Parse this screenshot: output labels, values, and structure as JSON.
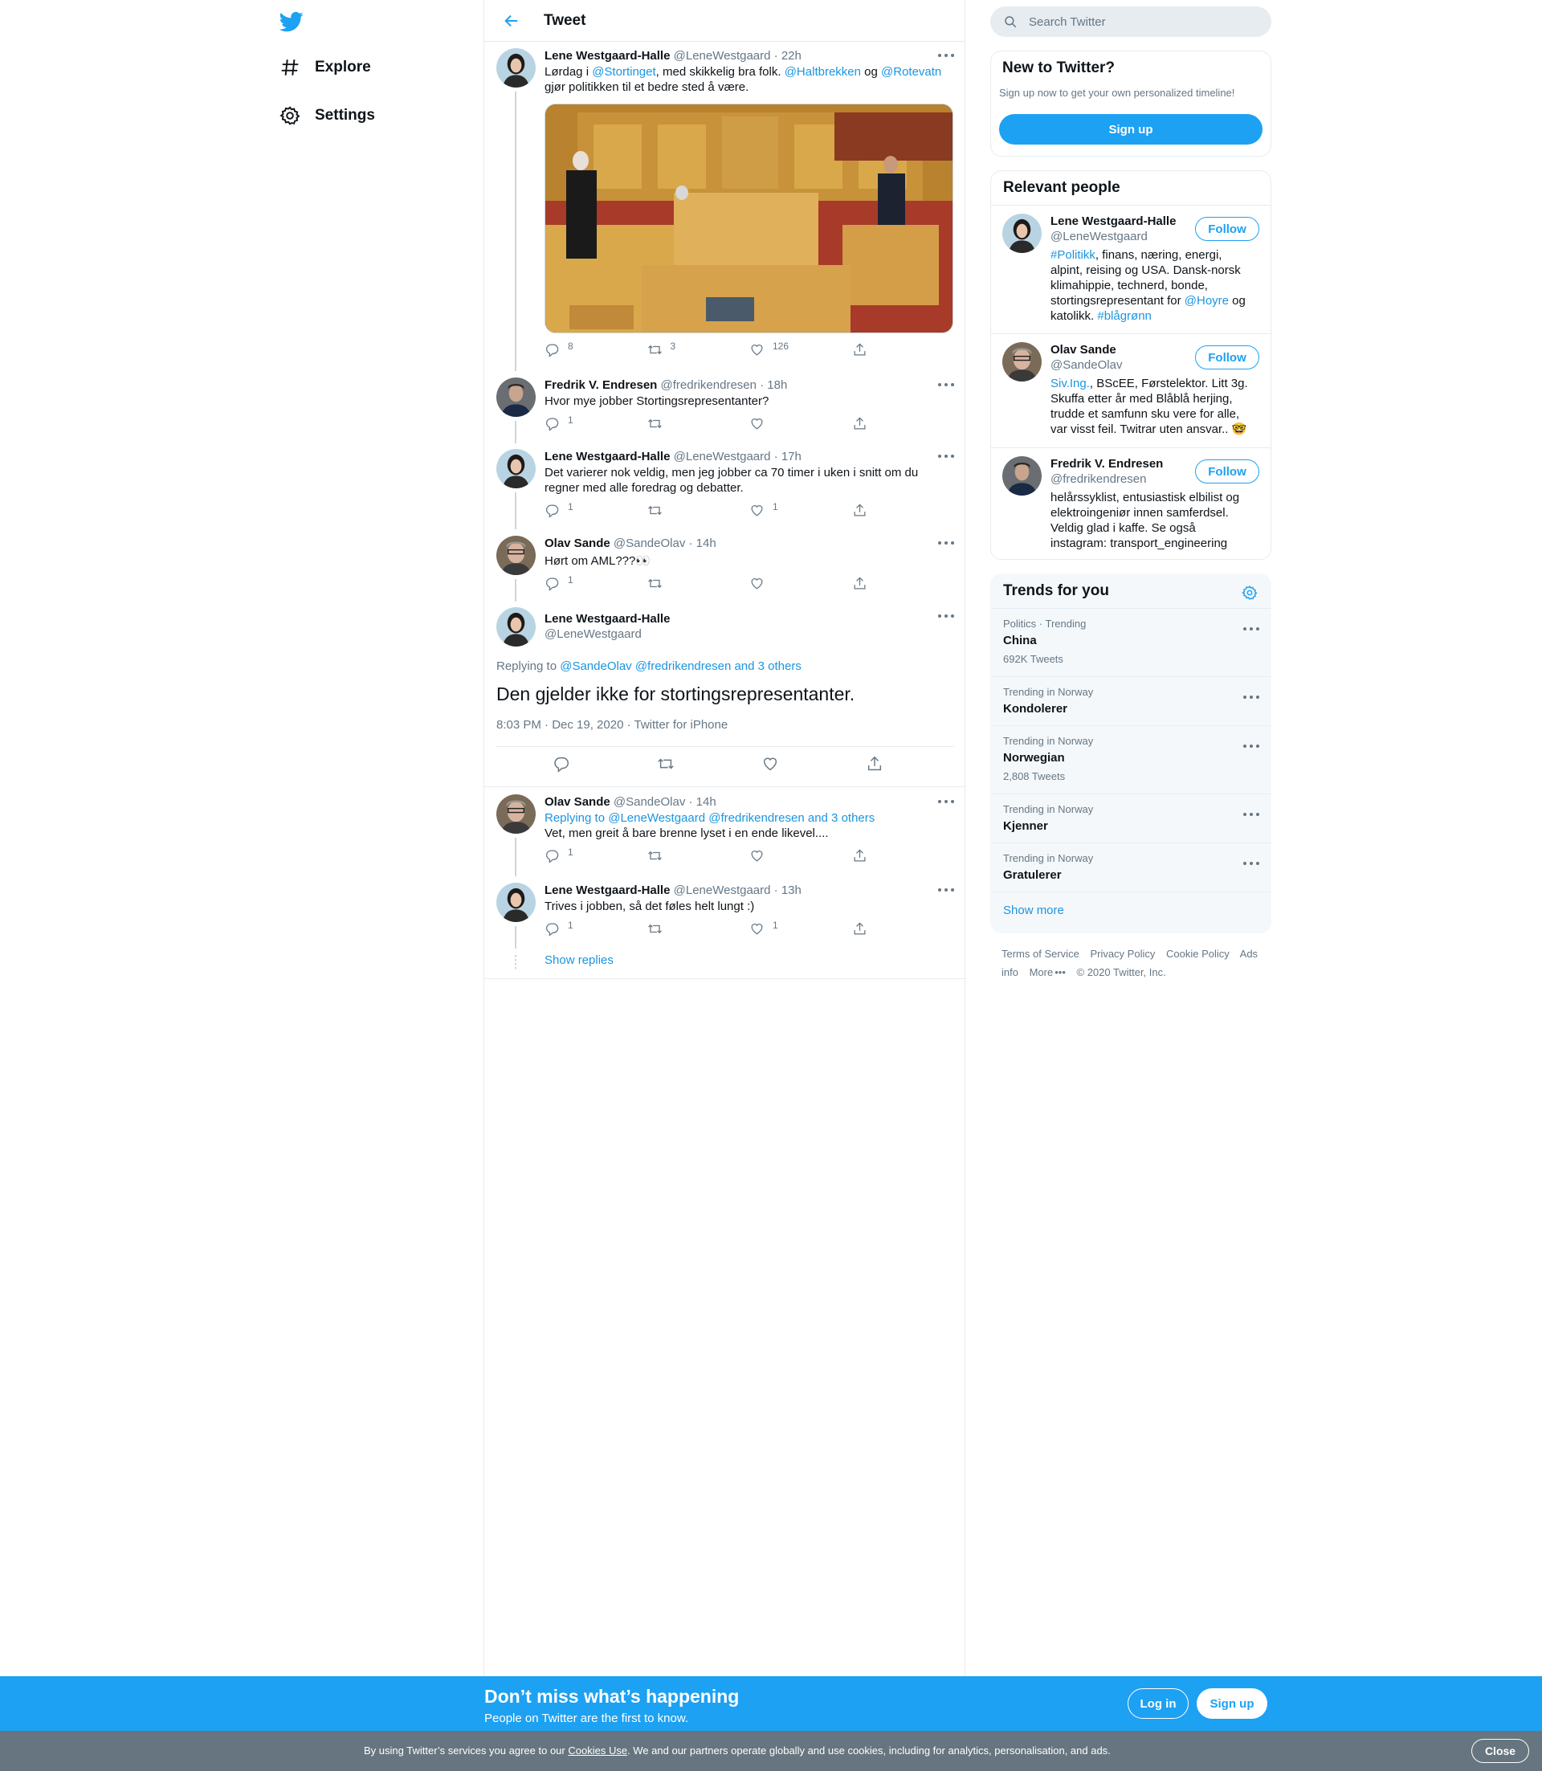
{
  "nav": {
    "items": [
      {
        "label": "Explore",
        "icon": "hashtag-icon"
      },
      {
        "label": "Settings",
        "icon": "gear-icon"
      }
    ]
  },
  "header": {
    "title": "Tweet"
  },
  "tweets": [
    {
      "name": "Lene Westgaard-Halle",
      "handle": "@LeneWestgaard",
      "time": "· 22h",
      "text_parts": [
        "Lørdag i ",
        "@Stortinget",
        ", med skikkelig bra folk. ",
        "@Haltbrekken",
        " og ",
        "@Rotevatn",
        " gjør politikken til et bedre sted å være."
      ],
      "replies": "8",
      "retweets": "3",
      "likes": "126"
    },
    {
      "name": "Fredrik V. Endresen",
      "handle": "@fredrikendresen",
      "time": "· 18h",
      "text": "Hvor mye jobber Stortingsrepresentanter?",
      "replies": "1",
      "retweets": "",
      "likes": ""
    },
    {
      "name": "Lene Westgaard-Halle",
      "handle": "@LeneWestgaard",
      "time": "· 17h",
      "text": "Det varierer nok veldig, men jeg jobber ca 70 timer i uken i snitt om du regner med alle foredrag og debatter.",
      "replies": "1",
      "retweets": "",
      "likes": "1"
    },
    {
      "name": "Olav Sande",
      "handle": "@SandeOlav",
      "time": "· 14h",
      "text": "Hørt om AML???👀",
      "replies": "1",
      "retweets": "",
      "likes": ""
    }
  ],
  "focus": {
    "name": "Lene Westgaard-Halle",
    "handle": "@LeneWestgaard",
    "replying_label": "Replying to",
    "replying_to": "@SandeOlav @fredrikendresen and 3 others",
    "text": "Den gjelder ikke for stortingsrepresentanter.",
    "meta": "8:03 PM · Dec 19, 2020 · Twitter for iPhone"
  },
  "replies": [
    {
      "name": "Olav Sande",
      "handle": "@SandeOlav",
      "time": "· 14h",
      "replying_label": "Replying to",
      "replying_to": "@LeneWestgaard @fredrikendresen and 3 others",
      "text": "Vet, men greit å bare brenne lyset i en ende likevel....",
      "replies": "1",
      "retweets": "",
      "likes": ""
    },
    {
      "name": "Lene Westgaard-Halle",
      "handle": "@LeneWestgaard",
      "time": "· 13h",
      "text": "Trives i jobben, så det føles helt lungt :)",
      "replies": "1",
      "retweets": "",
      "likes": "1"
    }
  ],
  "show_replies": "Show replies",
  "search": {
    "placeholder": "Search Twitter"
  },
  "new_to_twitter": {
    "title": "New to Twitter?",
    "subtitle": "Sign up now to get your own personalized timeline!",
    "button": "Sign up"
  },
  "relevant_people": {
    "title": "Relevant people",
    "follow_label": "Follow",
    "people": [
      {
        "name": "Lene Westgaard-Halle",
        "handle": "@LeneWestgaard",
        "bio_parts": [
          "#Politikk",
          ", finans, næring, energi, alpint, reising og USA. Dansk-norsk klimahippie, technerd, bonde, stortingsrepresentant for ",
          "@Hoyre",
          " og katolikk. ",
          "#blågrønn"
        ]
      },
      {
        "name": "Olav Sande",
        "handle": "@SandeOlav",
        "bio_parts": [
          "Siv.Ing.",
          ", BScEE, Førstelektor. Litt 3g. Skuffa etter år med Blåblå herjing, trudde et samfunn sku vere for alle, var visst feil. Twitrar uten ansvar.. 🤓"
        ]
      },
      {
        "name": "Fredrik V. Endresen",
        "handle": "@fredrikendresen",
        "bio": "helårssyklist, entusiastisk elbilist og elektroingeniør innen samferdsel. Veldig glad i kaffe. Se også instagram: transport_engineering"
      }
    ]
  },
  "trends": {
    "title": "Trends for you",
    "items": [
      {
        "context": "Politics · Trending",
        "name": "China",
        "count": "692K Tweets"
      },
      {
        "context": "Trending in Norway",
        "name": "Kondolerer",
        "count": ""
      },
      {
        "context": "Trending in Norway",
        "name": "Norwegian",
        "count": "2,808 Tweets"
      },
      {
        "context": "Trending in Norway",
        "name": "Kjenner",
        "count": ""
      },
      {
        "context": "Trending in Norway",
        "name": "Gratulerer",
        "count": ""
      }
    ],
    "show_more": "Show more"
  },
  "footer": {
    "links": [
      "Terms of Service",
      "Privacy Policy",
      "Cookie Policy",
      "Ads info",
      "More",
      "© 2020 Twitter, Inc."
    ]
  },
  "signup_bar": {
    "title": "Don’t miss what’s happening",
    "subtitle": "People on Twitter are the first to know.",
    "login": "Log in",
    "signup": "Sign up"
  },
  "cookie": {
    "text_before": "By using Twitter’s services you agree to our ",
    "link": "Cookies Use",
    "text_after": ". We and our partners operate globally and use cookies, including for analytics, personalisation, and ads.",
    "close": "Close"
  },
  "colors": {
    "accent": "#1da1f2",
    "link": "#1b95e0",
    "muted": "#657786",
    "cookie_bg": "#66757f"
  }
}
